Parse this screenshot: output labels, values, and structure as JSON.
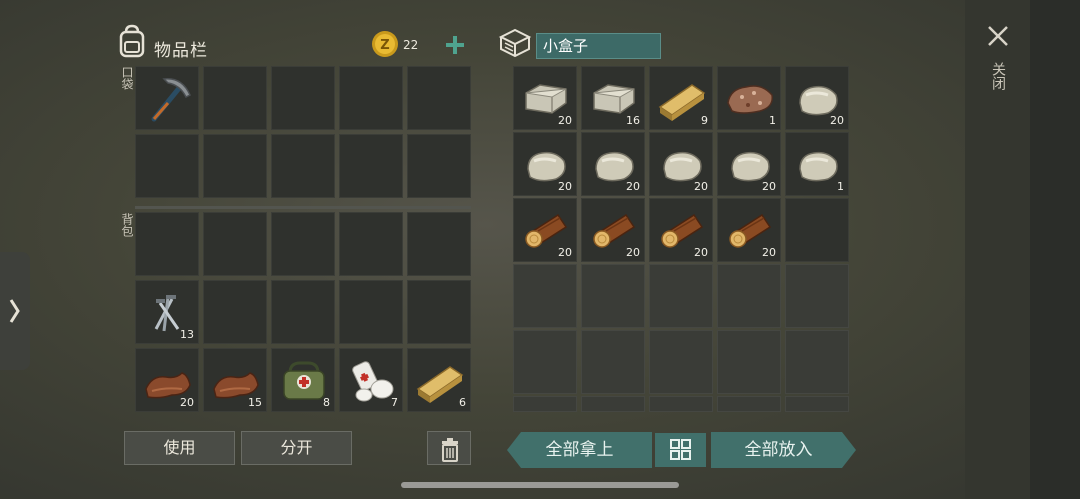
{
  "inventory": {
    "title": "物品栏",
    "coins": "22",
    "pocket_label": "口袋",
    "backpack_label": "背包",
    "pocket_slots": [
      {
        "icon": "pickaxe-icon",
        "qty": ""
      },
      null,
      null,
      null,
      null,
      null,
      null,
      null,
      null,
      null
    ],
    "backpack_slots": [
      null,
      null,
      null,
      null,
      null,
      {
        "icon": "nails-icon",
        "qty": "13"
      },
      null,
      null,
      null,
      null,
      {
        "icon": "leather-icon",
        "qty": "20"
      },
      {
        "icon": "leather-icon",
        "qty": "15"
      },
      {
        "icon": "medkit-bag-icon",
        "qty": "8"
      },
      {
        "icon": "bandage-icon",
        "qty": "7"
      },
      {
        "icon": "plank-icon",
        "qty": "6"
      }
    ],
    "use_label": "使用",
    "split_label": "分开"
  },
  "container": {
    "name": "小盒子",
    "slots": [
      {
        "icon": "stone-block-icon",
        "qty": "20"
      },
      {
        "icon": "stone-block-icon",
        "qty": "16"
      },
      {
        "icon": "plank-icon",
        "qty": "9"
      },
      {
        "icon": "iron-ore-icon",
        "qty": "1"
      },
      {
        "icon": "stone-icon",
        "qty": "20"
      },
      {
        "icon": "stone-icon",
        "qty": "20"
      },
      {
        "icon": "stone-icon",
        "qty": "20"
      },
      {
        "icon": "stone-icon",
        "qty": "20"
      },
      {
        "icon": "stone-icon",
        "qty": "20"
      },
      {
        "icon": "stone-icon",
        "qty": "1"
      },
      {
        "icon": "log-icon",
        "qty": "20"
      },
      {
        "icon": "log-icon",
        "qty": "20"
      },
      {
        "icon": "log-icon",
        "qty": "20"
      },
      {
        "icon": "log-icon",
        "qty": "20"
      },
      null
    ],
    "take_all_label": "全部拿上",
    "put_all_label": "全部放入"
  },
  "close_label": "关闭",
  "colors": {
    "accent": "#41706b",
    "background": "#444538",
    "slot": "#2f312d"
  }
}
